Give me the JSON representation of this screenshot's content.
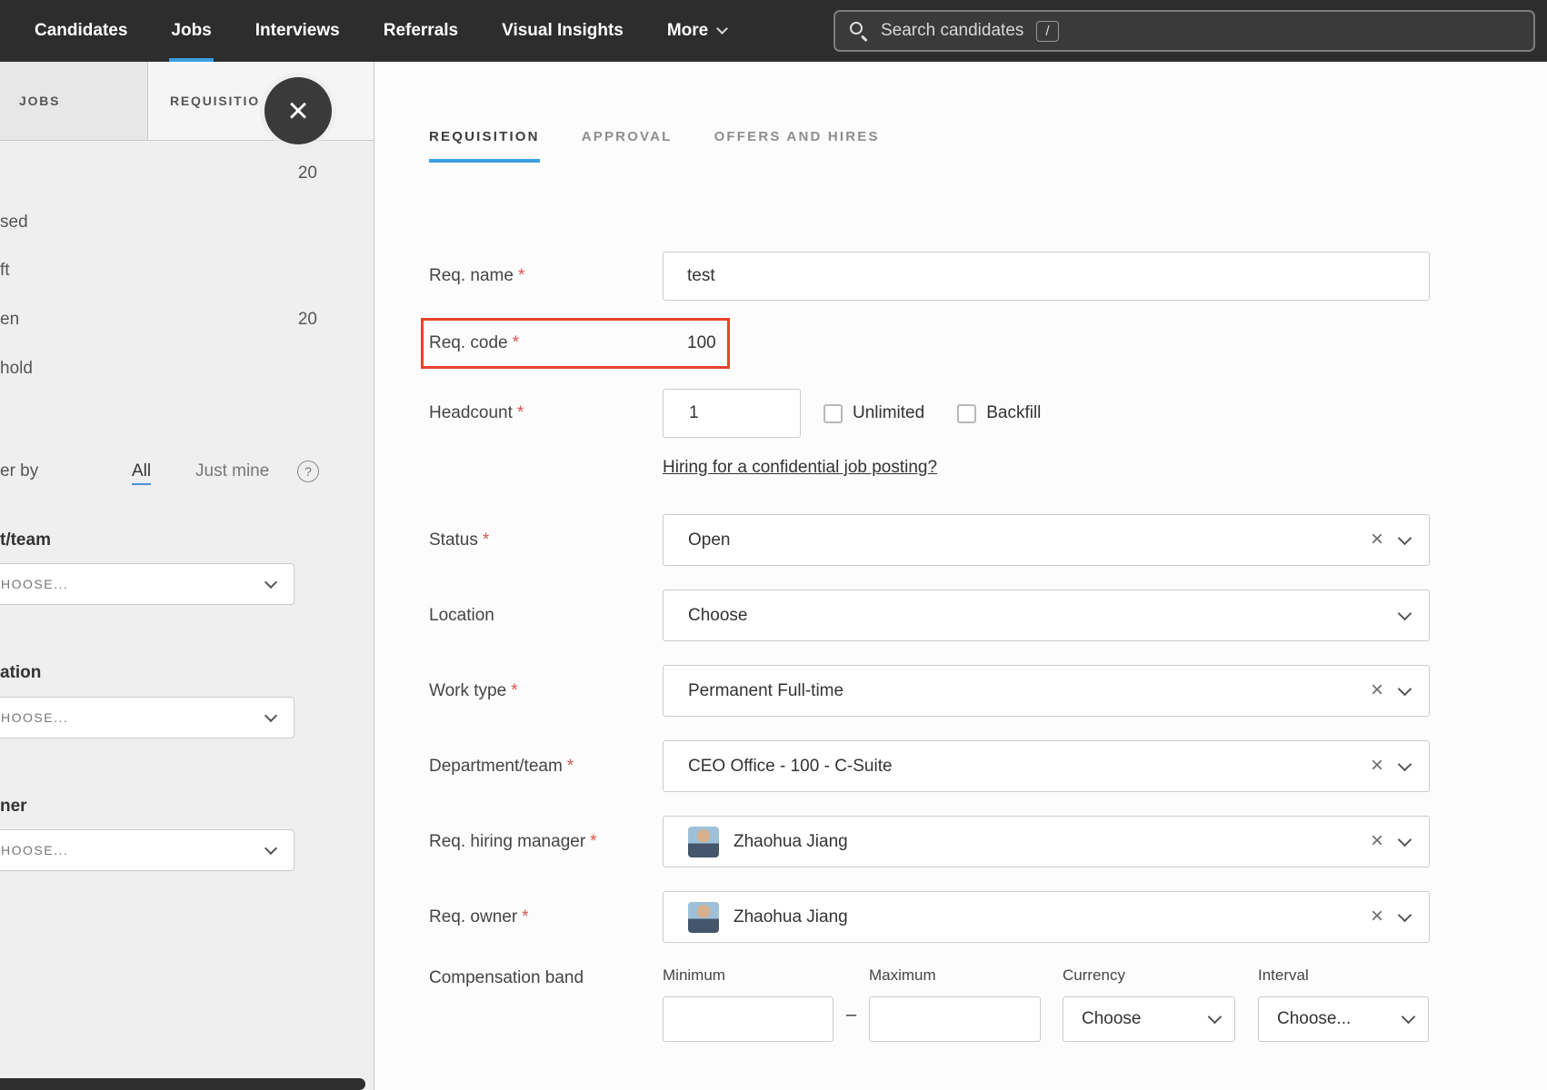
{
  "required_mark": "*",
  "icons": {
    "close": "×",
    "clear": "×",
    "help": "?"
  },
  "colors": {
    "nav_bg": "#2d2d2d",
    "accent_blue": "#3aa0e0",
    "annotation_red": "#e8432c",
    "required_red": "#d9534f"
  },
  "topnav": {
    "items": [
      {
        "label": "Candidates",
        "active": false
      },
      {
        "label": "Jobs",
        "active": true
      },
      {
        "label": "Interviews",
        "active": false
      },
      {
        "label": "Referrals",
        "active": false
      },
      {
        "label": "Visual Insights",
        "active": false
      },
      {
        "label": "More",
        "active": false
      }
    ],
    "search": {
      "placeholder": "Search candidates",
      "shortcut": "/"
    }
  },
  "sidebar": {
    "tabs": {
      "jobs": "JOBS",
      "requisitions": "REQUISITIO"
    },
    "list": [
      {
        "label": "",
        "count": "20"
      },
      {
        "label": "sed",
        "count": ""
      },
      {
        "label": "ft",
        "count": ""
      },
      {
        "label": "en",
        "count": "20"
      },
      {
        "label": "hold",
        "count": ""
      }
    ],
    "filter": {
      "label": "er by",
      "all": "All",
      "just_mine": "Just mine"
    },
    "facets": [
      {
        "label": "t/team",
        "value": "HOOSE..."
      },
      {
        "label": "ation",
        "value": "HOOSE..."
      },
      {
        "label": "ner",
        "value": "HOOSE..."
      }
    ]
  },
  "main": {
    "tabs": [
      {
        "label": "REQUISITION",
        "active": true
      },
      {
        "label": "APPROVAL",
        "active": false
      },
      {
        "label": "OFFERS AND HIRES",
        "active": false
      }
    ],
    "form": {
      "req_name": {
        "label": "Req. name",
        "value": "test"
      },
      "req_code": {
        "label": "Req. code",
        "value": "100"
      },
      "headcount": {
        "label": "Headcount",
        "value": "1",
        "checkboxes": [
          {
            "label": "Unlimited",
            "checked": false
          },
          {
            "label": "Backfill",
            "checked": false
          }
        ]
      },
      "confidential_link": "Hiring for a confidential job posting?",
      "status": {
        "label": "Status",
        "value": "Open"
      },
      "location": {
        "label": "Location",
        "value": "Choose"
      },
      "work_type": {
        "label": "Work type",
        "value": "Permanent Full-time"
      },
      "department": {
        "label": "Department/team",
        "value": "CEO Office - 100 - C-Suite"
      },
      "hiring_manager": {
        "label": "Req. hiring manager",
        "value": "Zhaohua Jiang"
      },
      "req_owner": {
        "label": "Req. owner",
        "value": "Zhaohua Jiang"
      },
      "compensation": {
        "label": "Compensation band",
        "minimum_label": "Minimum",
        "maximum_label": "Maximum",
        "currency_label": "Currency",
        "interval_label": "Interval",
        "minimum_value": "",
        "maximum_value": "",
        "currency_value": "Choose",
        "interval_value": "Choose...",
        "separator": "–"
      }
    }
  }
}
